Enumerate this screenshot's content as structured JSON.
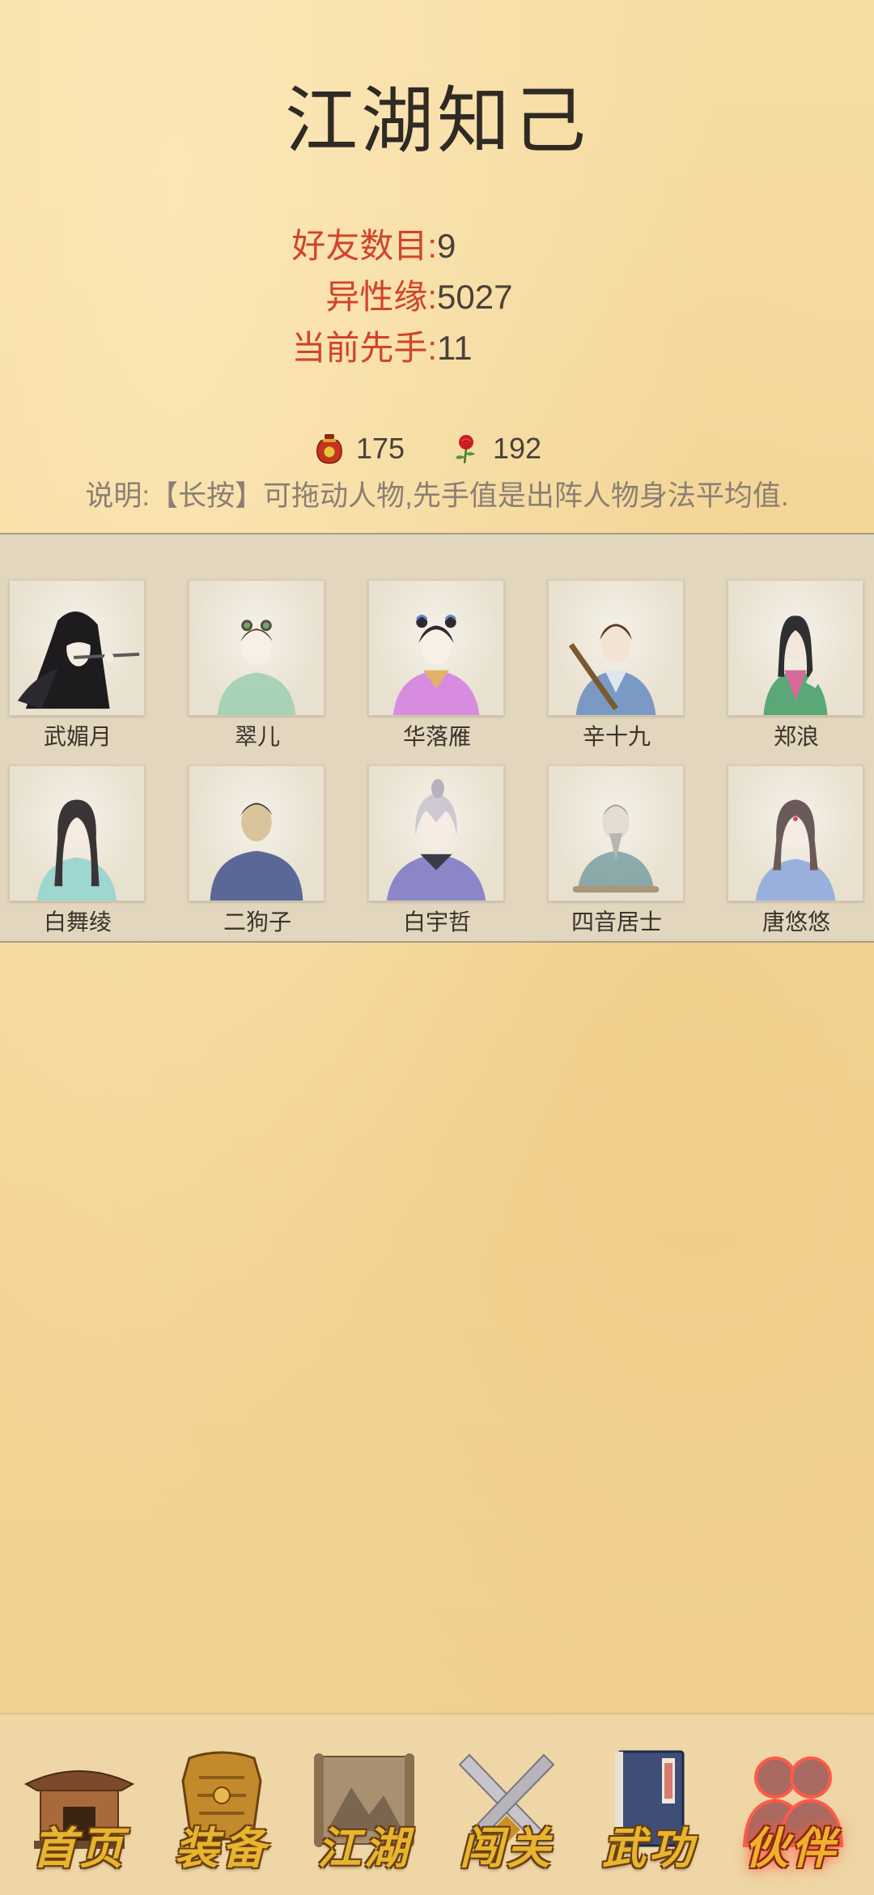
{
  "page": {
    "title": "江湖知己"
  },
  "stats": [
    {
      "label": "好友数目:",
      "value": "9"
    },
    {
      "label": "异性缘:",
      "value": "5027"
    },
    {
      "label": "当前先手:",
      "value": "11"
    }
  ],
  "resources": {
    "wine_icon": "wine-jar-icon",
    "wine_count": "175",
    "rose_icon": "rose-icon",
    "rose_count": "192"
  },
  "note": "说明:【长按】可拖动人物,先手值是出阵人物身法平均值.",
  "friends": [
    {
      "name": "武媚月"
    },
    {
      "name": "翠儿"
    },
    {
      "name": "华落雁"
    },
    {
      "name": "辛十九"
    },
    {
      "name": "郑浪"
    },
    {
      "name": "白舞绫"
    },
    {
      "name": "二狗子"
    },
    {
      "name": "白宇哲"
    },
    {
      "name": "四音居士"
    },
    {
      "name": "唐悠悠"
    }
  ],
  "nav": [
    {
      "label": "首页",
      "icon": "temple-icon",
      "active": false
    },
    {
      "label": "装备",
      "icon": "armor-icon",
      "active": false
    },
    {
      "label": "江湖",
      "icon": "scroll-map-icon",
      "active": false
    },
    {
      "label": "闯关",
      "icon": "crossed-swords-icon",
      "active": false
    },
    {
      "label": "武功",
      "icon": "book-icon",
      "active": false
    },
    {
      "label": "伙伴",
      "icon": "companions-icon",
      "active": true
    }
  ],
  "colors": {
    "accent_red": "#d2432a",
    "nav_gold": "#e7b52e",
    "panel_bg": "#e2d6bf"
  }
}
